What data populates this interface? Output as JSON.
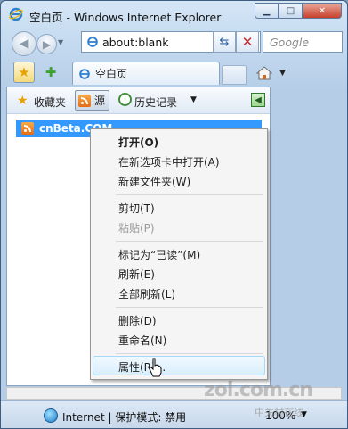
{
  "window": {
    "title": "空白页 - Windows Internet Explorer"
  },
  "nav": {
    "address": "about:blank",
    "search_placeholder": "Google"
  },
  "tabs": [
    {
      "label": "空白页"
    }
  ],
  "favorites_pane": {
    "favorites_label": "收藏夹",
    "feeds_label": "源",
    "history_label": "历史记录",
    "items": [
      {
        "label": "cnBeta.COM",
        "selected": true
      }
    ]
  },
  "context_menu": {
    "items": [
      {
        "label": "打开(O)",
        "bold": true
      },
      {
        "label": "在新选项卡中打开(A)"
      },
      {
        "label": "新建文件夹(W)"
      },
      {
        "label": "剪切(T)"
      },
      {
        "label": "粘贴(P)",
        "disabled": true
      },
      {
        "label": "标记为“已读”(M)"
      },
      {
        "label": "刷新(E)"
      },
      {
        "label": "全部刷新(L)"
      },
      {
        "label": "删除(D)"
      },
      {
        "label": "重命名(N)"
      },
      {
        "label": "属性(R)...",
        "hovered": true
      }
    ]
  },
  "status": {
    "zone": "Internet | 保护模式: 禁用",
    "zoom": "100%"
  },
  "watermark": {
    "text": "zol.com.cn",
    "sub": "中关村在线"
  },
  "colors": {
    "selection": "#3399ff",
    "window_frame": "#c0d7ee"
  }
}
